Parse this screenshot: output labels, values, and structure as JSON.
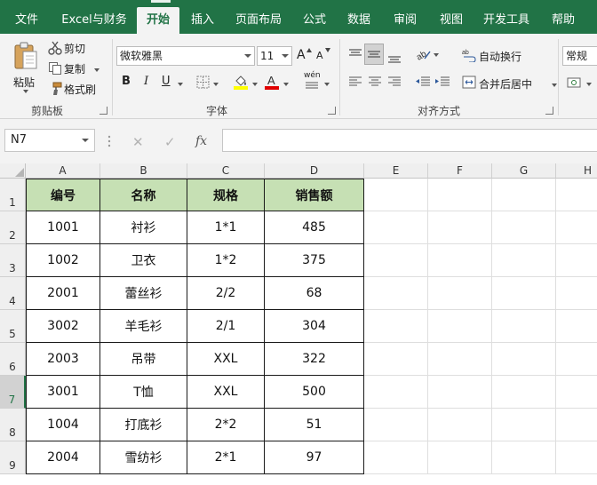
{
  "tabs": [
    {
      "label": "文件",
      "active": false
    },
    {
      "label": "Excel与财务",
      "active": false
    },
    {
      "label": "开始",
      "active": true
    },
    {
      "label": "插入",
      "active": false
    },
    {
      "label": "页面布局",
      "active": false
    },
    {
      "label": "公式",
      "active": false
    },
    {
      "label": "数据",
      "active": false
    },
    {
      "label": "审阅",
      "active": false
    },
    {
      "label": "视图",
      "active": false
    },
    {
      "label": "开发工具",
      "active": false
    },
    {
      "label": "帮助",
      "active": false
    }
  ],
  "ribbon": {
    "clipboard": {
      "paste": "粘贴",
      "cut": "剪切",
      "copy": "复制",
      "format_painter": "格式刷",
      "group": "剪贴板"
    },
    "font": {
      "name": "微软雅黑",
      "size": "11",
      "bold": "B",
      "italic": "I",
      "underline": "U",
      "grow": "A",
      "shrink": "A",
      "wen": "wén",
      "group": "字体"
    },
    "alignment": {
      "wrap": "自动换行",
      "merge": "合并后居中",
      "group": "对齐方式"
    },
    "number": {
      "format": "常规"
    }
  },
  "formula_bar": {
    "name_box": "N7",
    "fx": "fx",
    "cancel": "✕",
    "enter": "✓",
    "formula": ""
  },
  "columns": [
    "A",
    "B",
    "C",
    "D",
    "E",
    "F",
    "G",
    "H"
  ],
  "rows": [
    "1",
    "2",
    "3",
    "4",
    "5",
    "6",
    "7",
    "8",
    "9"
  ],
  "selected": {
    "row": "7",
    "col": "N"
  },
  "table": {
    "headers": [
      "编号",
      "名称",
      "规格",
      "销售额"
    ],
    "data": [
      [
        "1001",
        "衬衫",
        "1*1",
        "485"
      ],
      [
        "1002",
        "卫衣",
        "1*2",
        "375"
      ],
      [
        "2001",
        "蕾丝衫",
        "2/2",
        "68"
      ],
      [
        "3002",
        "羊毛衫",
        "2/1",
        "304"
      ],
      [
        "2003",
        "吊带",
        "XXL",
        "322"
      ],
      [
        "3001",
        "T恤",
        "XXL",
        "500"
      ],
      [
        "1004",
        "打底衫",
        "2*2",
        "51"
      ],
      [
        "2004",
        "雪纺衫",
        "2*1",
        "97"
      ]
    ]
  },
  "colors": {
    "accent": "#217346",
    "header_fill": "#c6e0b4",
    "font_color_bar": "#e00000",
    "fill_color_bar": "#ffff00"
  }
}
